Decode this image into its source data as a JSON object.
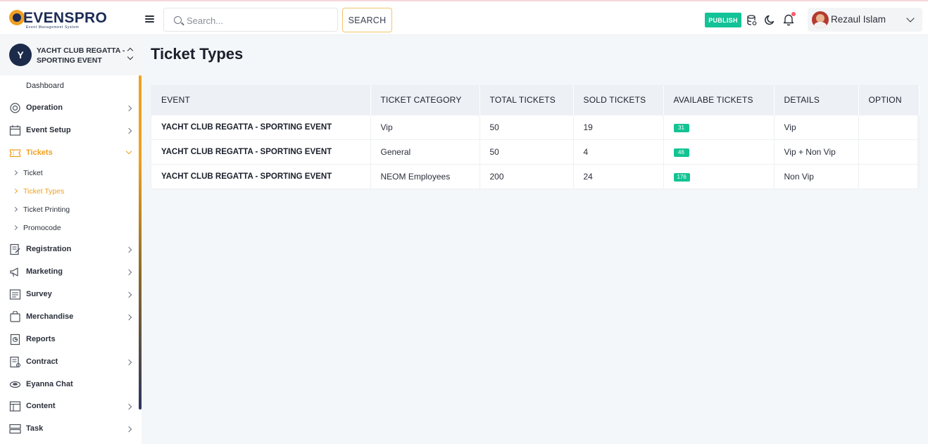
{
  "app": {
    "logo_text": "EVENSPRO",
    "logo_tagline": "Event Management System"
  },
  "header": {
    "search_placeholder": "Search...",
    "search_button": "SEARCH",
    "publish_button": "PUBLISH",
    "user_name": "Rezaul Islam"
  },
  "sidebar": {
    "event_initial": "Y",
    "event_name": "YACHT CLUB REGATTA - SPORTING EVENT",
    "dashboard": "Dashboard",
    "items": [
      {
        "label": "Operation",
        "icon": "operation-icon",
        "has_children": true
      },
      {
        "label": "Event Setup",
        "icon": "calendar-icon",
        "has_children": true
      },
      {
        "label": "Tickets",
        "icon": "ticket-icon",
        "has_children": true,
        "expanded": true
      },
      {
        "label": "Registration",
        "icon": "registration-icon",
        "has_children": true
      },
      {
        "label": "Marketing",
        "icon": "marketing-icon",
        "has_children": true
      },
      {
        "label": "Survey",
        "icon": "survey-icon",
        "has_children": true
      },
      {
        "label": "Merchandise",
        "icon": "merchandise-icon",
        "has_children": true
      },
      {
        "label": "Reports",
        "icon": "reports-icon",
        "has_children": false
      },
      {
        "label": "Contract",
        "icon": "contract-icon",
        "has_children": true
      },
      {
        "label": "Eyanna Chat",
        "icon": "chat-icon",
        "has_children": false
      },
      {
        "label": "Content",
        "icon": "content-icon",
        "has_children": true
      },
      {
        "label": "Task",
        "icon": "task-icon",
        "has_children": true
      }
    ],
    "ticket_subitems": [
      {
        "label": "Ticket",
        "active": false
      },
      {
        "label": "Ticket Types",
        "active": true
      },
      {
        "label": "Ticket Printing",
        "active": false
      },
      {
        "label": "Promocode",
        "active": false
      }
    ]
  },
  "main": {
    "title": "Ticket Types",
    "columns": [
      "EVENT",
      "TICKET CATEGORY",
      "TOTAL TICKETS",
      "SOLD TICKETS",
      "AVAILABE TICKETS",
      "DETAILS",
      "OPTION"
    ],
    "rows": [
      {
        "event": "YACHT CLUB REGATTA - SPORTING EVENT",
        "category": "Vip",
        "total": "50",
        "sold": "19",
        "available": "31",
        "details": "Vip",
        "option": ""
      },
      {
        "event": "YACHT CLUB REGATTA - SPORTING EVENT",
        "category": "General",
        "total": "50",
        "sold": "4",
        "available": "46",
        "details": "Vip + Non Vip",
        "option": ""
      },
      {
        "event": "YACHT CLUB REGATTA - SPORTING EVENT",
        "category": "NEOM Employees",
        "total": "200",
        "sold": "24",
        "available": "176",
        "details": "Non Vip",
        "option": ""
      }
    ]
  },
  "colors": {
    "accent": "#f0a020",
    "publish": "#13c397",
    "badge": "#12c493",
    "brand_navy": "#1c2b57"
  }
}
